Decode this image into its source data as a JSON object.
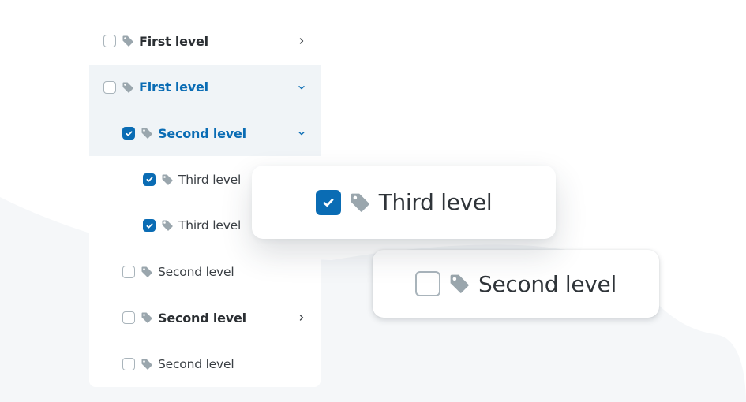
{
  "colors": {
    "accent": "#0a6cb4",
    "highlight_bg": "#f0f4f7",
    "tag_icon": "#9aa6ad",
    "checkbox_border": "#a9b4bb",
    "text": "#2b2f33",
    "blob": "#f5f7f9"
  },
  "tree": {
    "items": [
      {
        "label": "First level",
        "level": 1,
        "checked": false,
        "bold": true,
        "active": false,
        "highlight": false,
        "chevron": "chevron-right",
        "icon": "tag-icon"
      },
      {
        "label": "First level",
        "level": 1,
        "checked": false,
        "bold": true,
        "active": true,
        "highlight": true,
        "chevron": "chevron-down",
        "icon": "tag-icon"
      },
      {
        "label": "Second level",
        "level": 2,
        "checked": true,
        "bold": true,
        "active": true,
        "highlight": true,
        "chevron": "chevron-down",
        "icon": "tag-icon"
      },
      {
        "label": "Third level",
        "level": 3,
        "checked": true,
        "bold": false,
        "active": false,
        "highlight": false,
        "chevron": null,
        "icon": "tag-icon"
      },
      {
        "label": "Third level",
        "level": 3,
        "checked": true,
        "bold": false,
        "active": false,
        "highlight": false,
        "chevron": null,
        "icon": "tag-icon"
      },
      {
        "label": "Second level",
        "level": 2,
        "checked": false,
        "bold": false,
        "active": false,
        "highlight": false,
        "chevron": null,
        "icon": "tag-icon"
      },
      {
        "label": "Second level",
        "level": 2,
        "checked": false,
        "bold": true,
        "active": false,
        "highlight": false,
        "chevron": "chevron-right",
        "icon": "tag-icon"
      },
      {
        "label": "Second level",
        "level": 2,
        "checked": false,
        "bold": false,
        "active": false,
        "highlight": false,
        "chevron": null,
        "icon": "tag-icon"
      }
    ]
  },
  "zoom_cards": [
    {
      "label": "Third level",
      "checked": true,
      "icon": "tag-icon"
    },
    {
      "label": "Second level",
      "checked": false,
      "icon": "tag-icon"
    }
  ]
}
